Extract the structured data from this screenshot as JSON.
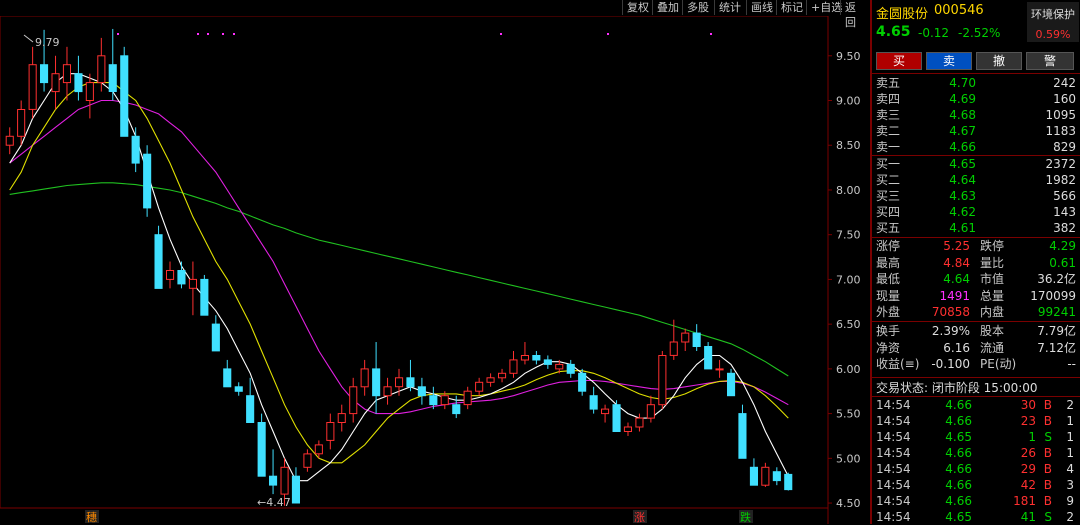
{
  "toolbar": {
    "items": [
      "复权",
      "叠加",
      "多股",
      "统计",
      "画线",
      "标记",
      "+自选",
      "返回"
    ]
  },
  "stock": {
    "name": "金圆股份",
    "code": "000546",
    "sector": "环境保护",
    "sector_change": "0.59%",
    "price": "4.65",
    "change": "-0.12",
    "change_pct": "-2.52%"
  },
  "actions": [
    "买",
    "卖",
    "撤",
    "警"
  ],
  "asks": [
    {
      "label": "卖五",
      "price": "4.70",
      "vol": "242"
    },
    {
      "label": "卖四",
      "price": "4.69",
      "vol": "160"
    },
    {
      "label": "卖三",
      "price": "4.68",
      "vol": "1095"
    },
    {
      "label": "卖二",
      "price": "4.67",
      "vol": "1183"
    },
    {
      "label": "卖一",
      "price": "4.66",
      "vol": "829"
    }
  ],
  "bids": [
    {
      "label": "买一",
      "price": "4.65",
      "vol": "2372"
    },
    {
      "label": "买二",
      "price": "4.64",
      "vol": "1982"
    },
    {
      "label": "买三",
      "price": "4.63",
      "vol": "566"
    },
    {
      "label": "买四",
      "price": "4.62",
      "vol": "143"
    },
    {
      "label": "买五",
      "price": "4.61",
      "vol": "382"
    }
  ],
  "stats": [
    {
      "l1": "涨停",
      "v1": "5.25",
      "l2": "跌停",
      "v2": "4.29"
    },
    {
      "l1": "最高",
      "v1": "4.84",
      "l2": "量比",
      "v2": "0.61"
    },
    {
      "l1": "最低",
      "v1": "4.64",
      "l2": "市值",
      "v2": "36.2亿"
    },
    {
      "l1": "现量",
      "v1": "1491",
      "l2": "总量",
      "v2": "170099"
    },
    {
      "l1": "外盘",
      "v1": "70858",
      "l2": "内盘",
      "v2": "99241"
    }
  ],
  "stats2": [
    {
      "l1": "换手",
      "v1": "2.39%",
      "l2": "股本",
      "v2": "7.79亿"
    },
    {
      "l1": "净资",
      "v1": "6.16",
      "l2": "流通",
      "v2": "7.12亿"
    },
    {
      "l1": "收益(≡)",
      "v1": "-0.100",
      "l2": "PE(动)",
      "v2": "--"
    }
  ],
  "trade_status": "交易状态: 闭市阶段 15:00:00",
  "ticks": [
    {
      "time": "14:54",
      "price": "4.66",
      "vol": "30",
      "side": "B",
      "n": "2"
    },
    {
      "time": "14:54",
      "price": "4.66",
      "vol": "23",
      "side": "B",
      "n": "1"
    },
    {
      "time": "14:54",
      "price": "4.65",
      "vol": "1",
      "side": "S",
      "n": "1"
    },
    {
      "time": "14:54",
      "price": "4.66",
      "vol": "26",
      "side": "B",
      "n": "1"
    },
    {
      "time": "14:54",
      "price": "4.66",
      "vol": "29",
      "side": "B",
      "n": "4"
    },
    {
      "time": "14:54",
      "price": "4.66",
      "vol": "42",
      "side": "B",
      "n": "3"
    },
    {
      "time": "14:54",
      "price": "4.66",
      "vol": "181",
      "side": "B",
      "n": "9"
    },
    {
      "time": "14:54",
      "price": "4.65",
      "vol": "41",
      "side": "S",
      "n": "2"
    }
  ],
  "colors": {
    "up": "#ff3030",
    "down": "#40e0ff",
    "ma5": "#ffffff",
    "ma10": "#e0e000",
    "ma20": "#e020e0",
    "ma60": "#20c020"
  },
  "chart_data": {
    "type": "candlestick",
    "ylim": [
      4.4,
      9.9
    ],
    "yticks": [
      "9.50",
      "9.00",
      "8.50",
      "8.00",
      "7.50",
      "7.00",
      "6.50",
      "6.00",
      "5.50",
      "5.00",
      "4.50"
    ],
    "annotations": {
      "high_label": "9.79",
      "low_label": "←4.47"
    },
    "bottom_markers": [
      "穗",
      "涨",
      "跌"
    ],
    "candles": [
      [
        8.5,
        8.7,
        8.4,
        8.6
      ],
      [
        8.6,
        9.0,
        8.5,
        8.9
      ],
      [
        8.9,
        9.6,
        8.8,
        9.4
      ],
      [
        9.4,
        9.79,
        9.1,
        9.2
      ],
      [
        9.1,
        9.5,
        8.9,
        9.3
      ],
      [
        9.2,
        9.6,
        9.0,
        9.4
      ],
      [
        9.3,
        9.5,
        9.0,
        9.1
      ],
      [
        9.0,
        9.3,
        8.8,
        9.2
      ],
      [
        9.2,
        9.7,
        9.1,
        9.5
      ],
      [
        9.4,
        9.8,
        9.0,
        9.1
      ],
      [
        9.5,
        9.6,
        8.6,
        8.6
      ],
      [
        8.6,
        8.7,
        8.2,
        8.3
      ],
      [
        8.4,
        8.5,
        7.7,
        7.8
      ],
      [
        7.5,
        7.6,
        6.9,
        6.9
      ],
      [
        7.0,
        7.2,
        6.9,
        7.1
      ],
      [
        7.1,
        7.2,
        6.9,
        6.95
      ],
      [
        6.9,
        7.2,
        6.6,
        7.0
      ],
      [
        7.0,
        7.05,
        6.6,
        6.6
      ],
      [
        6.5,
        6.6,
        6.2,
        6.2
      ],
      [
        6.0,
        6.1,
        5.8,
        5.8
      ],
      [
        5.8,
        5.85,
        5.7,
        5.75
      ],
      [
        5.7,
        5.9,
        5.4,
        5.4
      ],
      [
        5.4,
        5.5,
        4.8,
        4.8
      ],
      [
        4.8,
        5.1,
        4.6,
        4.7
      ],
      [
        4.6,
        5.0,
        4.47,
        4.9
      ],
      [
        4.8,
        4.9,
        4.5,
        4.5
      ],
      [
        4.9,
        5.1,
        4.85,
        5.05
      ],
      [
        5.05,
        5.2,
        5.0,
        5.15
      ],
      [
        5.2,
        5.5,
        5.1,
        5.4
      ],
      [
        5.4,
        5.6,
        5.3,
        5.5
      ],
      [
        5.5,
        5.9,
        5.4,
        5.8
      ],
      [
        5.8,
        6.1,
        5.7,
        6.0
      ],
      [
        6.0,
        6.3,
        5.5,
        5.7
      ],
      [
        5.7,
        5.9,
        5.6,
        5.8
      ],
      [
        5.8,
        6.0,
        5.7,
        5.9
      ],
      [
        5.9,
        6.1,
        5.75,
        5.8
      ],
      [
        5.8,
        5.9,
        5.6,
        5.7
      ],
      [
        5.7,
        5.8,
        5.55,
        5.6
      ],
      [
        5.6,
        5.75,
        5.55,
        5.7
      ],
      [
        5.6,
        5.7,
        5.45,
        5.5
      ],
      [
        5.6,
        5.8,
        5.55,
        5.75
      ],
      [
        5.75,
        5.9,
        5.7,
        5.85
      ],
      [
        5.85,
        5.95,
        5.8,
        5.9
      ],
      [
        5.9,
        6.0,
        5.85,
        5.95
      ],
      [
        5.95,
        6.2,
        5.9,
        6.1
      ],
      [
        6.1,
        6.3,
        6.05,
        6.15
      ],
      [
        6.15,
        6.2,
        6.05,
        6.1
      ],
      [
        6.1,
        6.15,
        6.0,
        6.05
      ],
      [
        6.0,
        6.1,
        5.95,
        6.05
      ],
      [
        6.05,
        6.1,
        5.9,
        5.95
      ],
      [
        5.95,
        6.0,
        5.7,
        5.75
      ],
      [
        5.7,
        5.8,
        5.5,
        5.55
      ],
      [
        5.5,
        5.6,
        5.4,
        5.55
      ],
      [
        5.6,
        5.65,
        5.3,
        5.3
      ],
      [
        5.3,
        5.4,
        5.25,
        5.35
      ],
      [
        5.35,
        5.5,
        5.3,
        5.45
      ],
      [
        5.45,
        5.7,
        5.4,
        5.6
      ],
      [
        5.6,
        6.2,
        5.55,
        6.15
      ],
      [
        6.15,
        6.55,
        6.1,
        6.3
      ],
      [
        6.3,
        6.45,
        6.2,
        6.4
      ],
      [
        6.4,
        6.5,
        6.2,
        6.25
      ],
      [
        6.25,
        6.3,
        6.0,
        6.0
      ],
      [
        6.0,
        6.1,
        5.9,
        6.0
      ],
      [
        5.95,
        6.0,
        5.7,
        5.7
      ],
      [
        5.5,
        5.6,
        5.0,
        5.0
      ],
      [
        4.9,
        5.0,
        4.7,
        4.7
      ],
      [
        4.7,
        4.95,
        4.68,
        4.9
      ],
      [
        4.85,
        4.9,
        4.7,
        4.75
      ],
      [
        4.82,
        4.84,
        4.64,
        4.65
      ]
    ],
    "ma5": [
      8.3,
      8.5,
      8.8,
      9.0,
      9.2,
      9.3,
      9.3,
      9.25,
      9.2,
      9.1,
      8.9,
      8.6,
      8.2,
      7.8,
      7.45,
      7.15,
      6.95,
      6.8,
      6.65,
      6.45,
      6.2,
      5.95,
      5.6,
      5.3,
      5.0,
      4.75,
      4.75,
      4.85,
      4.95,
      5.1,
      5.3,
      5.5,
      5.65,
      5.7,
      5.75,
      5.8,
      5.75,
      5.72,
      5.68,
      5.65,
      5.65,
      5.68,
      5.72,
      5.78,
      5.85,
      5.95,
      6.02,
      6.08,
      6.08,
      6.05,
      5.95,
      5.85,
      5.72,
      5.6,
      5.5,
      5.45,
      5.45,
      5.55,
      5.7,
      5.9,
      6.05,
      6.15,
      6.15,
      6.05,
      5.85,
      5.6,
      5.3,
      5.05,
      4.8
    ],
    "ma10": [
      8.0,
      8.2,
      8.5,
      8.7,
      8.9,
      9.05,
      9.15,
      9.2,
      9.2,
      9.2,
      9.1,
      9.0,
      8.8,
      8.55,
      8.3,
      8.0,
      7.7,
      7.45,
      7.2,
      7.0,
      6.75,
      6.5,
      6.2,
      5.9,
      5.6,
      5.35,
      5.15,
      5.0,
      4.95,
      4.95,
      5.05,
      5.15,
      5.3,
      5.45,
      5.55,
      5.65,
      5.7,
      5.72,
      5.72,
      5.72,
      5.7,
      5.7,
      5.72,
      5.75,
      5.78,
      5.82,
      5.88,
      5.93,
      5.97,
      5.98,
      5.98,
      5.95,
      5.9,
      5.84,
      5.78,
      5.72,
      5.68,
      5.66,
      5.68,
      5.72,
      5.78,
      5.83,
      5.86,
      5.87,
      5.85,
      5.8,
      5.7,
      5.58,
      5.45
    ],
    "ma20": [
      8.3,
      8.4,
      8.5,
      8.6,
      8.7,
      8.8,
      8.9,
      8.95,
      9.0,
      9.0,
      8.98,
      8.95,
      8.9,
      8.85,
      8.75,
      8.65,
      8.5,
      8.35,
      8.2,
      8.0,
      7.8,
      7.6,
      7.4,
      7.2,
      6.95,
      6.7,
      6.45,
      6.2,
      6.0,
      5.8,
      5.65,
      5.55,
      5.5,
      5.5,
      5.5,
      5.52,
      5.55,
      5.58,
      5.6,
      5.62,
      5.63,
      5.64,
      5.65,
      5.67,
      5.7,
      5.74,
      5.78,
      5.82,
      5.85,
      5.86,
      5.87,
      5.87,
      5.86,
      5.84,
      5.82,
      5.8,
      5.78,
      5.77,
      5.78,
      5.8,
      5.82,
      5.84,
      5.86,
      5.86,
      5.84,
      5.8,
      5.74,
      5.67,
      5.6
    ],
    "ma60": [
      7.95,
      7.97,
      7.99,
      8.01,
      8.03,
      8.05,
      8.06,
      8.07,
      8.08,
      8.08,
      8.07,
      8.06,
      8.04,
      8.02,
      8.0,
      7.97,
      7.93,
      7.89,
      7.85,
      7.8,
      7.76,
      7.71,
      7.66,
      7.61,
      7.57,
      7.52,
      7.48,
      7.44,
      7.41,
      7.38,
      7.35,
      7.32,
      7.29,
      7.26,
      7.23,
      7.2,
      7.17,
      7.14,
      7.11,
      7.08,
      7.05,
      7.02,
      6.99,
      6.96,
      6.93,
      6.9,
      6.87,
      6.84,
      6.81,
      6.78,
      6.75,
      6.72,
      6.69,
      6.66,
      6.63,
      6.6,
      6.56,
      6.52,
      6.48,
      6.44,
      6.4,
      6.36,
      6.32,
      6.28,
      6.22,
      6.15,
      6.08,
      6.0,
      5.92
    ]
  }
}
